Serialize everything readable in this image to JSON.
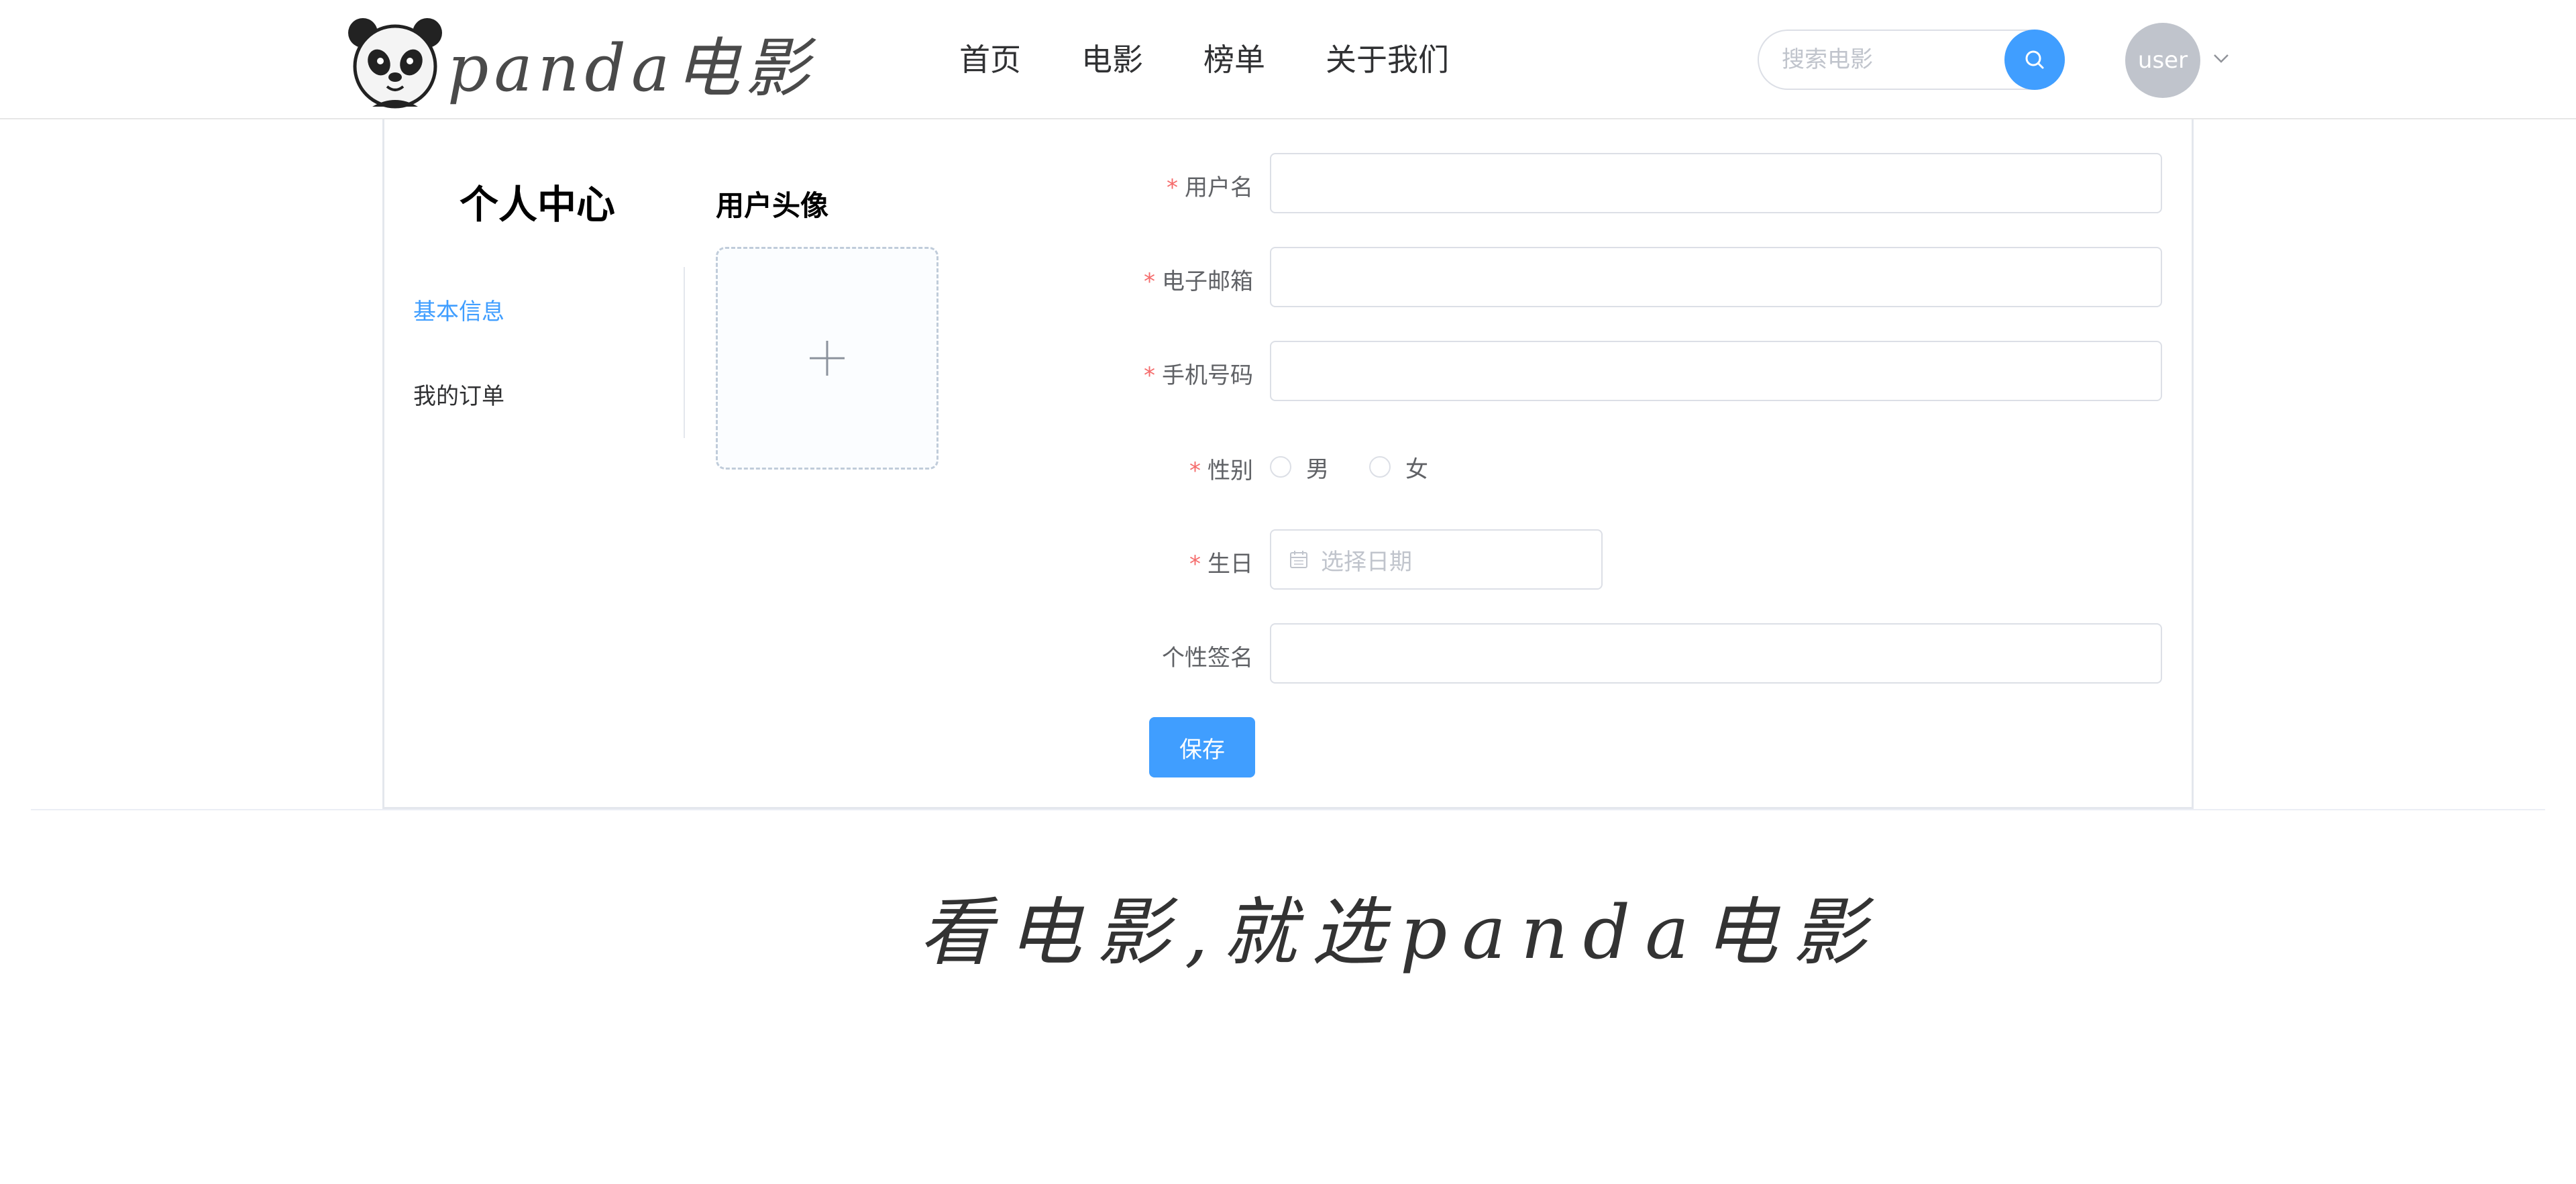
{
  "header": {
    "logo_text": "panda电影",
    "nav": [
      "首页",
      "电影",
      "榜单",
      "关于我们"
    ],
    "search": {
      "placeholder": "搜索电影",
      "value": ""
    },
    "user": {
      "avatar_text": "user"
    }
  },
  "sidebar": {
    "title": "个人中心",
    "items": [
      {
        "label": "基本信息",
        "active": true
      },
      {
        "label": "我的订单",
        "active": false
      }
    ]
  },
  "avatar_section": {
    "title": "用户头像"
  },
  "form": {
    "username": {
      "label": "用户名",
      "required": true,
      "value": ""
    },
    "email": {
      "label": "电子邮箱",
      "required": true,
      "value": ""
    },
    "phone": {
      "label": "手机号码",
      "required": true,
      "value": ""
    },
    "gender": {
      "label": "性别",
      "required": true,
      "options": [
        "男",
        "女"
      ],
      "selected": null
    },
    "birthday": {
      "label": "生日",
      "required": true,
      "placeholder": "选择日期",
      "value": ""
    },
    "signature": {
      "label": "个性签名",
      "required": false,
      "value": ""
    },
    "required_mark": "*",
    "save_label": "保存"
  },
  "footer": {
    "slogan": "看电影,就选panda电影"
  },
  "colors": {
    "accent": "#409eff",
    "required": "#f56c6c",
    "border": "#dcdfe6",
    "avatar_bg": "#c0c4cc"
  }
}
